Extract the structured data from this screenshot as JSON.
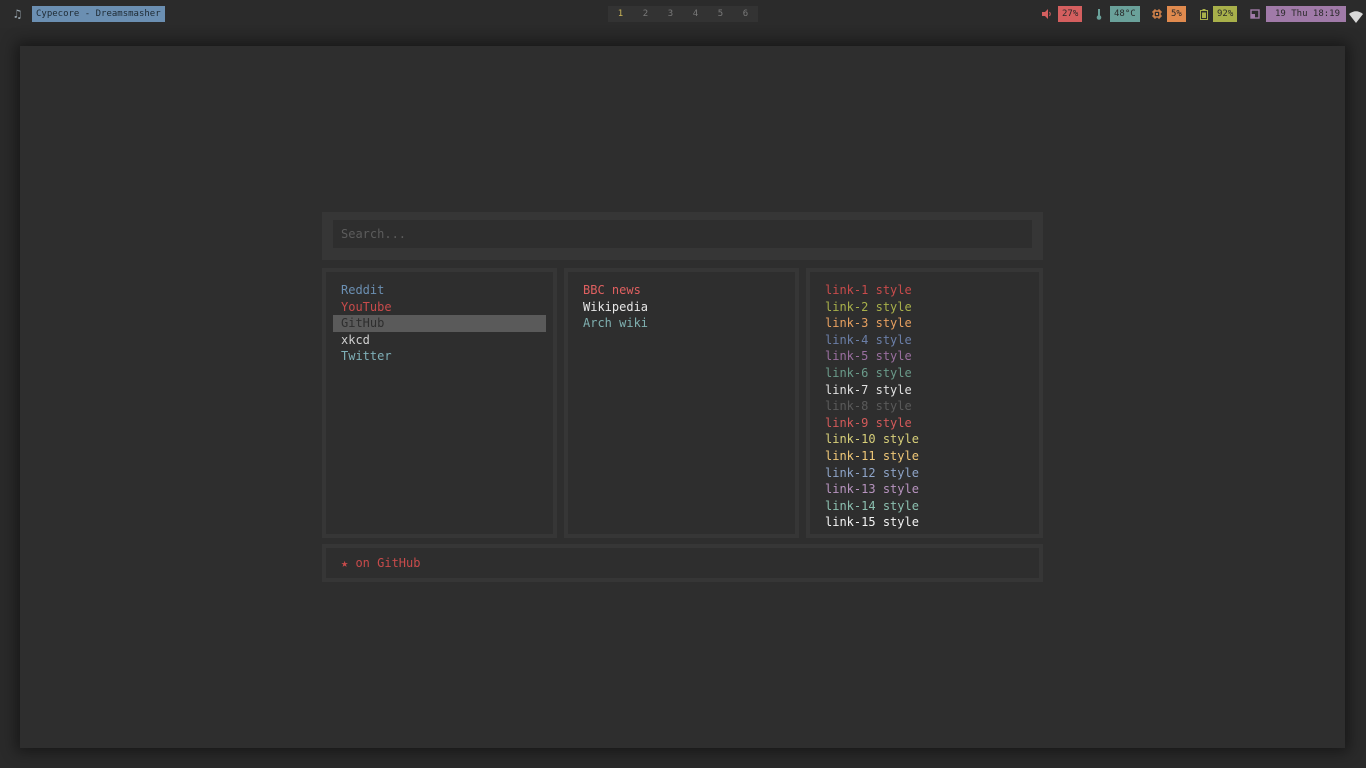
{
  "topbar": {
    "now_playing": "Cypecore - Dreamsmasher",
    "workspaces": [
      "1",
      "2",
      "3",
      "4",
      "5",
      "6"
    ],
    "active_workspace": "1",
    "volume": "27%",
    "temperature": "48°C",
    "cpu": "5%",
    "battery": "92%",
    "datetime": "19 Thu 18:19"
  },
  "colors": {
    "volume": "#d45f5f",
    "temperature": "#6aa19a",
    "cpu": "#e08a4e",
    "battery": "#a8b04a",
    "datetime": "#a07aa8",
    "now_playing": "#6b8fb2"
  },
  "search": {
    "placeholder": "Search..."
  },
  "columns": [
    {
      "links": [
        {
          "label": "Reddit",
          "color": "#6b8fb2"
        },
        {
          "label": "YouTube",
          "color": "#c84b4b"
        },
        {
          "label": "GitHub",
          "color": "#3a3a3a",
          "selected": true
        },
        {
          "label": "xkcd",
          "color": "#d0d0d0"
        },
        {
          "label": "Twitter",
          "color": "#7fb0b8"
        }
      ]
    },
    {
      "links": [
        {
          "label": "BBC news",
          "color": "#e06060"
        },
        {
          "label": "Wikipedia",
          "color": "#e8e8e8"
        },
        {
          "label": "Arch wiki",
          "color": "#7fb0b0"
        }
      ]
    },
    {
      "links": [
        {
          "label": "link-1",
          "suffix": "style",
          "color": "#c84b4b",
          "suffix_color": "#c84b4b"
        },
        {
          "label": "link-2",
          "suffix": "style",
          "color": "#a8b04a",
          "suffix_color": "#a8b04a"
        },
        {
          "label": "link-3",
          "suffix": "style",
          "color": "#e8a060",
          "suffix_color": "#e8a060"
        },
        {
          "label": "link-4",
          "suffix": "style",
          "color": "#6b7fa8",
          "suffix_color": "#6b7fa8"
        },
        {
          "label": "link-5",
          "suffix": "style",
          "color": "#9a6fa0",
          "suffix_color": "#9a6fa0"
        },
        {
          "label": "link-6",
          "suffix": "style",
          "color": "#6a9a8a",
          "suffix_color": "#6a9a8a"
        },
        {
          "label": "link-7",
          "suffix": "style",
          "color": "#e0e0e0",
          "suffix_color": "#e0e0e0"
        },
        {
          "label": "link-8",
          "suffix": "style",
          "color": "#5a5a5a",
          "suffix_color": "#5a5a5a"
        },
        {
          "label": "link-9",
          "suffix": "style",
          "color": "#d45a5a",
          "suffix_color": "#d45a5a"
        },
        {
          "label": "link-10",
          "suffix": "style",
          "color": "#d8d07a",
          "suffix_color": "#d8d07a"
        },
        {
          "label": "link-11",
          "suffix": "style",
          "color": "#f0c878",
          "suffix_color": "#f0c878"
        },
        {
          "label": "link-12",
          "suffix": "style",
          "color": "#8ea4c8",
          "suffix_color": "#8ea4c8"
        },
        {
          "label": "link-13",
          "suffix": "style",
          "color": "#b894c0",
          "suffix_color": "#b894c0"
        },
        {
          "label": "link-14",
          "suffix": "style",
          "color": "#8cc0b0",
          "suffix_color": "#8cc0b0"
        },
        {
          "label": "link-15",
          "suffix": "style",
          "color": "#f4f4f4",
          "suffix_color": "#f4f4f4"
        }
      ]
    }
  ],
  "footer": {
    "star_label": "★ on GitHub"
  }
}
